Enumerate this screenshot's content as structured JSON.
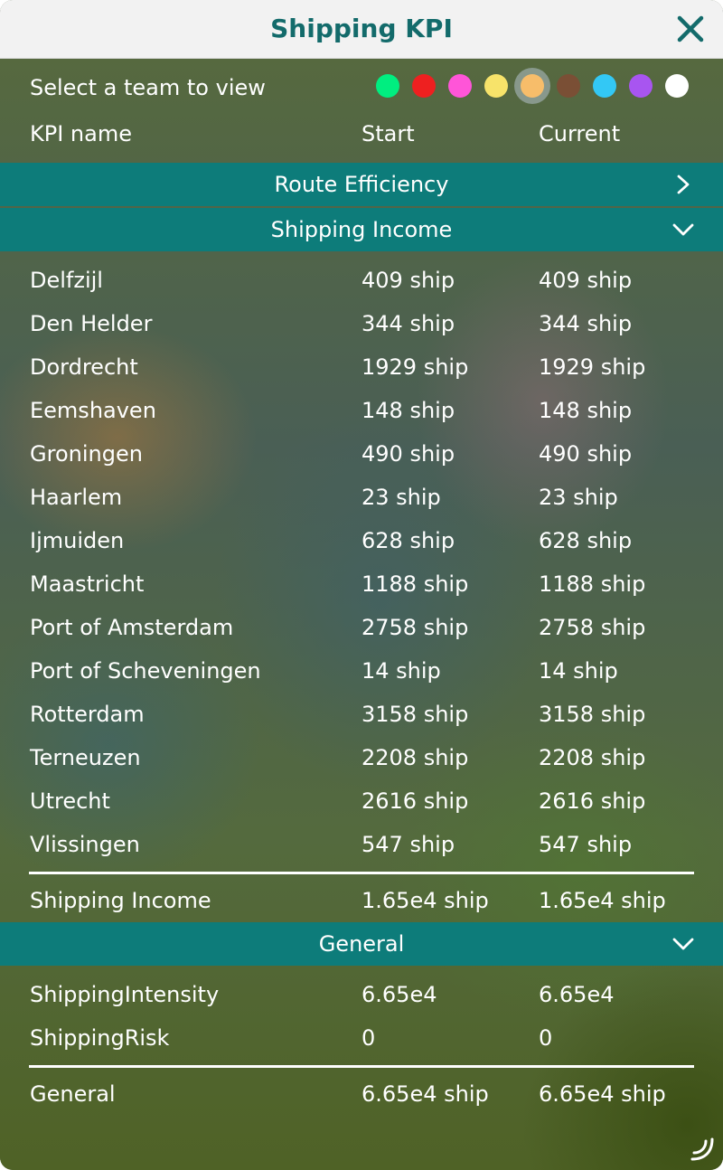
{
  "window": {
    "title": "Shipping KPI"
  },
  "team_selector": {
    "label": "Select a team to view",
    "colors": [
      "#00ee80",
      "#ee2020",
      "#ff55d8",
      "#f7e36a",
      "#f7bd6a",
      "#7a4f35",
      "#33c8f5",
      "#a855f0",
      "#ffffff"
    ],
    "selected_index": 4
  },
  "columns": {
    "name": "KPI name",
    "start": "Start",
    "current": "Current"
  },
  "sections": {
    "route_efficiency": {
      "title": "Route Efficiency",
      "expanded": false
    },
    "shipping_income": {
      "title": "Shipping Income",
      "expanded": true,
      "rows": [
        {
          "name": "Delfzijl",
          "start": "409 ship",
          "current": "409 ship"
        },
        {
          "name": "Den Helder",
          "start": "344 ship",
          "current": "344 ship"
        },
        {
          "name": "Dordrecht",
          "start": "1929 ship",
          "current": "1929 ship"
        },
        {
          "name": "Eemshaven",
          "start": "148 ship",
          "current": "148 ship"
        },
        {
          "name": "Groningen",
          "start": "490 ship",
          "current": "490 ship"
        },
        {
          "name": "Haarlem",
          "start": "23 ship",
          "current": "23 ship"
        },
        {
          "name": "Ijmuiden",
          "start": "628 ship",
          "current": "628 ship"
        },
        {
          "name": "Maastricht",
          "start": "1188 ship",
          "current": "1188 ship"
        },
        {
          "name": "Port of Amsterdam",
          "start": "2758 ship",
          "current": "2758 ship"
        },
        {
          "name": "Port of Scheveningen",
          "start": "14 ship",
          "current": "14 ship"
        },
        {
          "name": "Rotterdam",
          "start": "3158 ship",
          "current": "3158 ship"
        },
        {
          "name": "Terneuzen",
          "start": "2208 ship",
          "current": "2208 ship"
        },
        {
          "name": "Utrecht",
          "start": "2616 ship",
          "current": "2616 ship"
        },
        {
          "name": "Vlissingen",
          "start": "547 ship",
          "current": "547 ship"
        }
      ],
      "total": {
        "name": "Shipping Income",
        "start": "1.65e4 ship",
        "current": "1.65e4 ship"
      }
    },
    "general": {
      "title": "General",
      "expanded": true,
      "rows": [
        {
          "name": "ShippingIntensity",
          "start": "6.65e4",
          "current": "6.65e4"
        },
        {
          "name": "ShippingRisk",
          "start": "0",
          "current": "0"
        }
      ],
      "total": {
        "name": "General",
        "start": "6.65e4 ship",
        "current": "6.65e4 ship"
      }
    }
  },
  "icons": {
    "close": "close-icon",
    "expand": "chevron-right-icon",
    "collapse": "chevron-down-icon",
    "resize": "resize-handle-icon"
  }
}
